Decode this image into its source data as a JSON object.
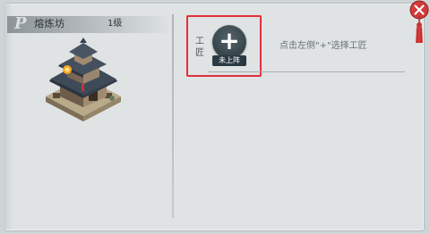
{
  "building": {
    "name": "熔炼坊",
    "level": "1级",
    "logo_icon": "stylized-p-logo-icon"
  },
  "craftsman_slot": {
    "label": "工匠",
    "status": "未上阵",
    "hint": "点击左侧\"+\"选择工匠",
    "add_icon": "plus-icon"
  },
  "window": {
    "close_icon": "close-x-icon",
    "decoration": "red-tassel-icon"
  },
  "colors": {
    "panel_bg": "#dfe3e4",
    "highlight": "#e0303a",
    "button_dark": "#34424a",
    "close_red": "#d23a3a"
  }
}
